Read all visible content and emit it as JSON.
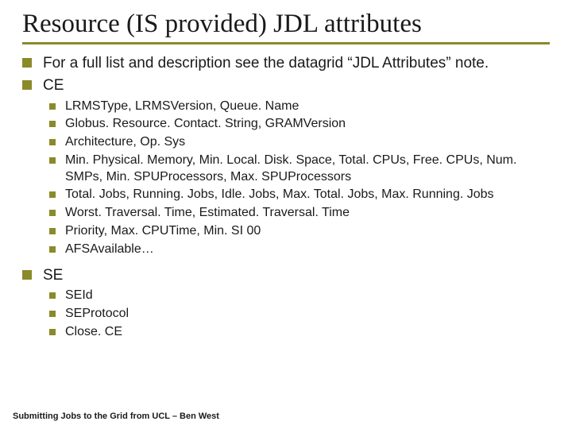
{
  "title": "Resource (IS provided) JDL attributes",
  "items": [
    {
      "text": "For a full list and description see the datagrid “JDL Attributes” note."
    },
    {
      "text": "CE",
      "sub": [
        "LRMSType, LRMSVersion, Queue. Name",
        "Globus. Resource. Contact. String, GRAMVersion",
        "Architecture, Op. Sys",
        "Min. Physical. Memory, Min. Local. Disk. Space, Total. CPUs, Free. CPUs, Num. SMPs, Min. SPUProcessors, Max. SPUProcessors",
        "Total. Jobs, Running. Jobs, Idle. Jobs, Max. Total. Jobs, Max. Running. Jobs",
        "Worst. Traversal. Time, Estimated. Traversal. Time",
        "Priority, Max. CPUTime, Min. SI 00",
        "AFSAvailable…"
      ]
    },
    {
      "text": "SE",
      "sub": [
        "SEId",
        "SEProtocol",
        "Close. CE"
      ]
    }
  ],
  "footer": "Submitting Jobs to the Grid from UCL – Ben West"
}
